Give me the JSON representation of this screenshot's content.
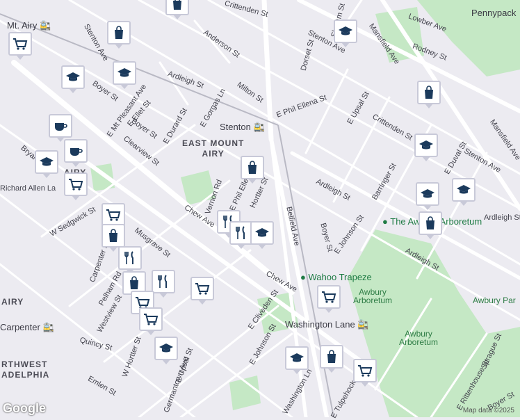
{
  "map": {
    "attribution": "Map data ©2025",
    "logo_text": "Google"
  },
  "neighborhoods": [
    {
      "name": "EAST MOUNT",
      "line2": "AIRY"
    },
    {
      "name": "AIRY",
      "line2": ""
    },
    {
      "name": "AIRY",
      "line2": ""
    },
    {
      "name": "RTHWEST",
      "line2": "ADELPHIA"
    }
  ],
  "streets": [
    "Crittenden St",
    "Stenton Ave",
    "Mansfield Ave",
    "Lowber Ave",
    "Rodney St",
    "Slocum St",
    "Dorset St",
    "Anderson St",
    "Ardleigh St",
    "Ardleigh St",
    "Milton St",
    "E Phil Ellena St",
    "E Upsal St",
    "Crittenden St",
    "Mansfield Ave",
    "Stenton Ave",
    "E Durard St",
    "E Gorgas Ln",
    "Stenton Ave",
    "Chew Ave",
    "Ardleigh St",
    "Barringer St",
    "E Duval St",
    "Ardleigh St",
    "Boyer St",
    "E Johnson St",
    "Belfield Ave",
    "Chew Ave",
    "E Cliveden St",
    "E Johnson St",
    "Washington Ln",
    "E Tulpehocken St",
    "Germantown Ave",
    "E Upsal St",
    "W Sedgwick St",
    "Musgrave St",
    "Carpenter Ln",
    "Pelham Rd",
    "Westview St",
    "W Hortter St",
    "Quincy St",
    "Emlen St",
    "Vernon Rd",
    "E Phil Ellen",
    "Hortter St",
    "Boyer St",
    "Clearview St",
    "E Ellet St",
    "E Mt Pleasant Ave",
    "Boyer St",
    "Bryan St",
    "Richard Allen La",
    "Sprague St",
    "E Rittenhouse St",
    "Boyer St",
    "Ardleigh St"
  ],
  "places": {
    "mt_airy": "Mt. Airy",
    "stenton": "Stenton",
    "pennypack": "Pennypack",
    "arboretum_poi": "The Awbury Arboretum",
    "wahoo": "Wahoo Trapeze",
    "awbury_1": "Awbury",
    "awbury_1b": "Arboretum",
    "awbury_2": "Awbury",
    "awbury_2b": "Arboretum",
    "awbury_park": "Awbury Par",
    "washington_lane": "Washington Lane",
    "carpenter": "Carpenter"
  },
  "colors": {
    "background": "#ecebf1",
    "road": "#ffffff",
    "park": "#c5e8c5",
    "pin_border": "#c8c9d8",
    "pin_icon": "#1b3a5c"
  },
  "markers": [
    {
      "icon": "bag-icon",
      "type": "shopping"
    },
    {
      "icon": "graduation-cap-icon",
      "type": "school"
    },
    {
      "icon": "cart-icon",
      "type": "grocery"
    },
    {
      "icon": "bag-icon",
      "type": "shopping"
    },
    {
      "icon": "graduation-cap-icon",
      "type": "school"
    },
    {
      "icon": "graduation-cap-icon",
      "type": "school"
    },
    {
      "icon": "bag-icon",
      "type": "shopping"
    },
    {
      "icon": "coffee-icon",
      "type": "cafe"
    },
    {
      "icon": "coffee-icon",
      "type": "cafe"
    },
    {
      "icon": "graduation-cap-icon",
      "type": "school"
    },
    {
      "icon": "cart-icon",
      "type": "grocery"
    },
    {
      "icon": "bag-icon",
      "type": "shopping"
    },
    {
      "icon": "graduation-cap-icon",
      "type": "school"
    },
    {
      "icon": "graduation-cap-icon",
      "type": "school"
    },
    {
      "icon": "graduation-cap-icon",
      "type": "school"
    },
    {
      "icon": "bag-icon",
      "type": "shopping"
    },
    {
      "icon": "fork-knife-icon",
      "type": "restaurant"
    },
    {
      "icon": "fork-knife-icon",
      "type": "restaurant"
    },
    {
      "icon": "graduation-cap-icon",
      "type": "school"
    },
    {
      "icon": "cart-icon",
      "type": "grocery"
    },
    {
      "icon": "bag-icon",
      "type": "shopping"
    },
    {
      "icon": "fork-knife-icon",
      "type": "restaurant"
    },
    {
      "icon": "bag-icon",
      "type": "shopping"
    },
    {
      "icon": "fork-knife-icon",
      "type": "restaurant"
    },
    {
      "icon": "cart-icon",
      "type": "grocery"
    },
    {
      "icon": "cart-icon",
      "type": "grocery"
    },
    {
      "icon": "cart-icon",
      "type": "grocery"
    },
    {
      "icon": "graduation-cap-icon",
      "type": "school"
    },
    {
      "icon": "graduation-cap-icon",
      "type": "school"
    },
    {
      "icon": "bag-icon",
      "type": "shopping"
    },
    {
      "icon": "cart-icon",
      "type": "grocery"
    },
    {
      "icon": "cart-icon",
      "type": "grocery"
    }
  ]
}
